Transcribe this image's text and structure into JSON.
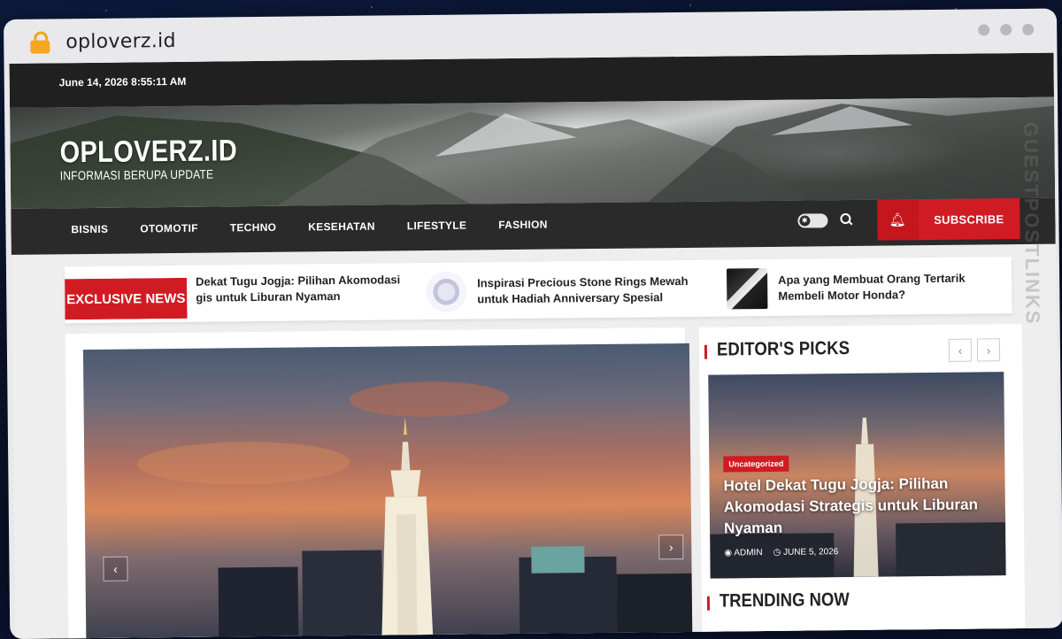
{
  "browser": {
    "url": "oploverz.id"
  },
  "topbar": {
    "datetime": "June 14, 2026 8:55:11 AM"
  },
  "header": {
    "site_name": "OPLOVERZ.ID",
    "tagline": "INFORMASI BERUPA UPDATE"
  },
  "nav": {
    "items": [
      "BISNIS",
      "OTOMOTIF",
      "TECHNO",
      "KESEHATAN",
      "LIFESTYLE",
      "FASHION"
    ],
    "subscribe_label": "SUBSCRIBE"
  },
  "ticker": {
    "label": "EXCLUSIVE NEWS",
    "items": [
      {
        "title": "Dekat Tugu Jogja: Pilihan Akomodasi gis untuk Liburan Nyaman"
      },
      {
        "title": "Inspirasi Precious Stone Rings Mewah untuk Hadiah Anniversary Spesial"
      },
      {
        "title": "Apa yang Membuat Orang Tertarik Membeli Motor Honda?"
      }
    ]
  },
  "editors_picks": {
    "title": "EDITOR'S PICKS",
    "prev": "‹",
    "next": "›",
    "post": {
      "category": "Uncategorized",
      "title": "Hotel Dekat Tugu Jogja: Pilihan Akomodasi Strategis untuk Liburan Nyaman",
      "author": "ADMIN",
      "date": "JUNE 5, 2026"
    }
  },
  "trending": {
    "title": "TRENDING NOW"
  },
  "hero": {
    "prev": "‹",
    "next": "›"
  },
  "watermark": {
    "text": "GUESTPOSTLINKS"
  },
  "colors": {
    "accent": "#d11b22",
    "dark": "#202020"
  },
  "icons": {
    "lock": "lock-icon",
    "search": "search-icon",
    "bell": "bell-icon",
    "theme": "theme-toggle-icon",
    "user": "user-icon",
    "clock": "clock-icon"
  }
}
